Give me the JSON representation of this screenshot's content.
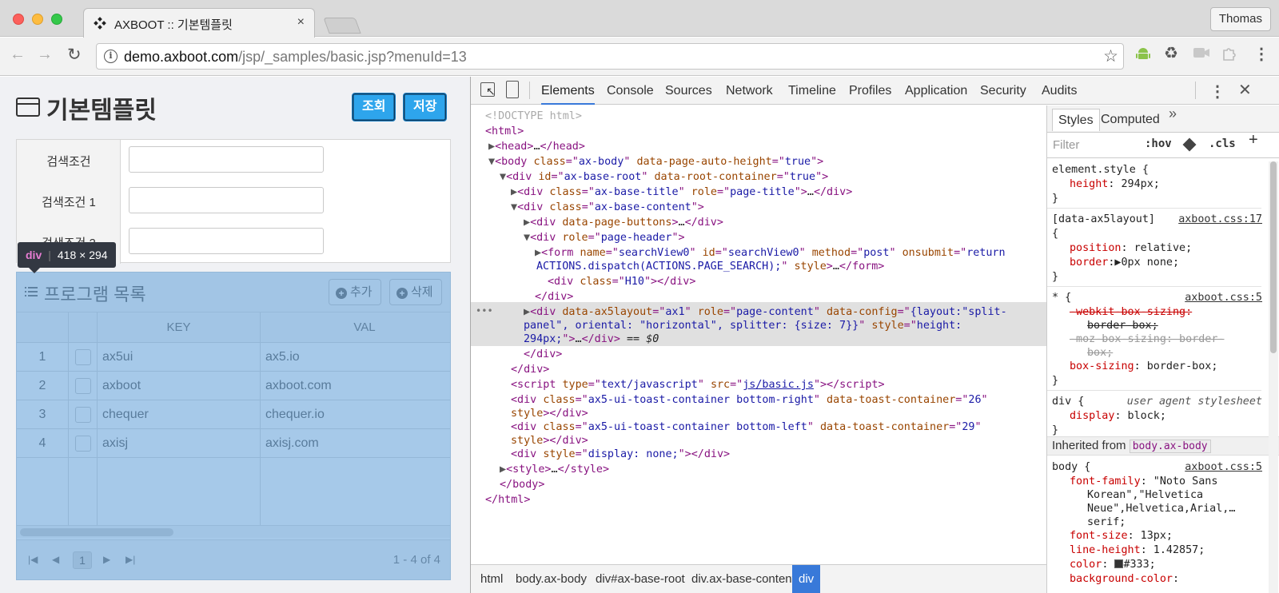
{
  "browser": {
    "tab_title": "AXBOOT :: 기본템플릿",
    "tab_close": "×",
    "profile_name": "Thomas",
    "url_host": "demo.axboot.com",
    "url_path": "/jsp/_samples/basic.jsp?menuId=13"
  },
  "page": {
    "title": "기본템플릿",
    "search_button": "조회",
    "save_button": "저장",
    "search_labels": [
      "검색조건",
      "검색조건 1",
      "검색조건 2"
    ],
    "tooltip_tag": "div",
    "tooltip_size": "418 × 294",
    "grid_title": "프로그램 목록",
    "add_button": "추가",
    "delete_button": "삭제",
    "columns": [
      "KEY",
      "VAL"
    ],
    "rows": [
      {
        "num": "1",
        "key": "ax5ui",
        "val": "ax5.io"
      },
      {
        "num": "2",
        "key": "axboot",
        "val": "axboot.com"
      },
      {
        "num": "3",
        "key": "chequer",
        "val": "chequer.io"
      },
      {
        "num": "4",
        "key": "axisj",
        "val": "axisj.com"
      }
    ],
    "pager_current": "1",
    "pager_info": "1 - 4 of 4"
  },
  "devtools": {
    "tabs": [
      "Elements",
      "Console",
      "Sources",
      "Network",
      "Timeline",
      "Profiles",
      "Application",
      "Security",
      "Audits"
    ],
    "active_tab": "Elements",
    "breadcrumbs": [
      "html",
      "body.ax-body",
      "div#ax-base-root",
      "div.ax-base-content",
      "div"
    ],
    "styles_tabs": [
      "Styles",
      "Computed"
    ],
    "filter_placeholder": "Filter",
    "hov": ":hov",
    "cls": ".cls",
    "inherited_label": "Inherited from",
    "inherited_from": "body.ax-body"
  },
  "colors": {
    "primary_button": "#2ea5ec",
    "highlight_overlay": "#6fa8dc",
    "devtools_active": "#3879d9"
  }
}
